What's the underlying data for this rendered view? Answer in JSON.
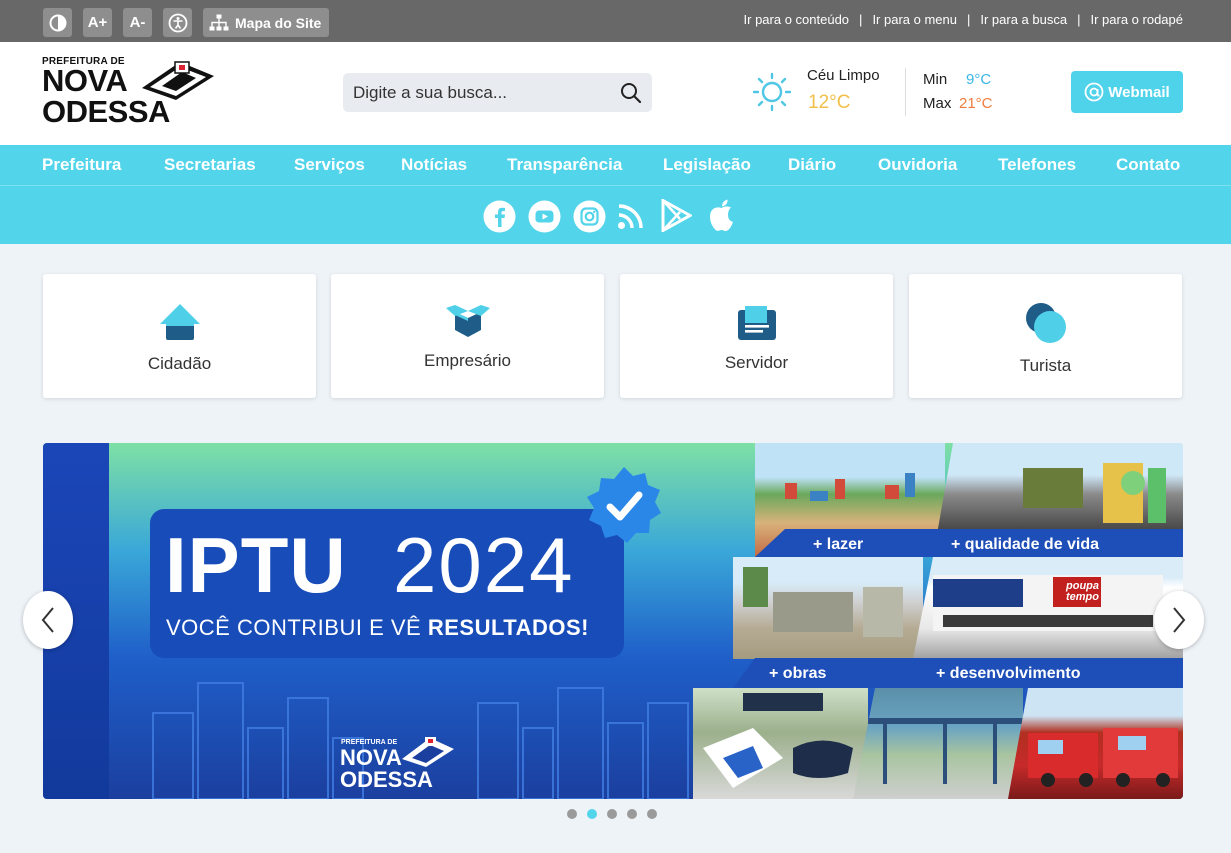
{
  "accessibility": {
    "contrast_icon": "contrast-icon",
    "increase_font": "A+",
    "decrease_font": "A-",
    "accessibility_icon": "accessibility-icon",
    "sitemap_label": "Mapa do Site"
  },
  "skip_links": [
    "Ir para o conteúdo",
    "Ir para o menu",
    "Ir para a busca",
    "Ir para o rodapé"
  ],
  "logo": {
    "line1": "PREFEITURA DE",
    "line2": "NOVA",
    "line3": "ODESSA"
  },
  "search": {
    "placeholder": "Digite a sua busca..."
  },
  "weather": {
    "condition": "Céu Limpo",
    "temperature": "12°C",
    "min_label": "Min",
    "min_value": "9°C",
    "max_label": "Max",
    "max_value": "21°C"
  },
  "webmail_label": "Webmail",
  "nav": [
    "Prefeitura",
    "Secretarias",
    "Serviços",
    "Notícias",
    "Transparência",
    "Legislação",
    "Diário",
    "Ouvidoria",
    "Telefones",
    "Contato"
  ],
  "social": [
    "facebook-icon",
    "youtube-icon",
    "instagram-icon",
    "rss-icon",
    "google-play-icon",
    "apple-icon"
  ],
  "profiles": [
    "Cidadão",
    "Empresário",
    "Servidor",
    "Turista"
  ],
  "banner": {
    "title": "IPTU",
    "year": "2024",
    "subtitle_prefix": "VOCÊ CONTRIBUI E VÊ ",
    "subtitle_bold": "RESULTADOS!",
    "logo_line1": "PREFEITURA DE",
    "logo_line2": "NOVA",
    "logo_line3": "ODESSA",
    "tags": [
      "+ lazer",
      "+ qualidade de vida",
      "+ obras",
      "+ desenvolvimento"
    ],
    "sign_text": "poupa tempo"
  },
  "carousel": {
    "slides": 5,
    "active": 2
  },
  "colors": {
    "accent": "#52d4ea",
    "topbar": "#686868",
    "temp": "#f2c04a",
    "min": "#3ab6e6",
    "max": "#f07c3a"
  }
}
